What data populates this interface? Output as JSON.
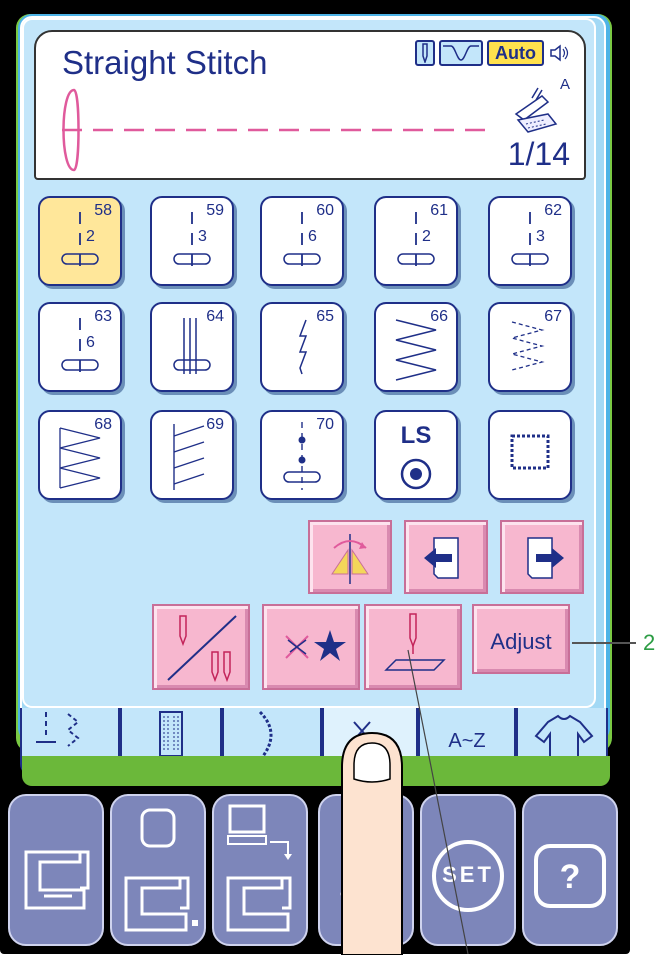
{
  "header": {
    "title": "Straight Stitch",
    "auto_label": "Auto",
    "presser_foot": "A",
    "page": "1/14"
  },
  "stitch_buttons": [
    {
      "num": "58",
      "value": "2",
      "selected": true
    },
    {
      "num": "59",
      "value": "3"
    },
    {
      "num": "60",
      "value": "6"
    },
    {
      "num": "61",
      "value": "2"
    },
    {
      "num": "62",
      "value": "3"
    },
    {
      "num": "63",
      "value": "6"
    },
    {
      "num": "64",
      "value": ""
    },
    {
      "num": "65",
      "value": ""
    },
    {
      "num": "66",
      "value": ""
    },
    {
      "num": "67",
      "value": ""
    },
    {
      "num": "68",
      "value": ""
    },
    {
      "num": "69",
      "value": ""
    },
    {
      "num": "70",
      "value": ""
    },
    {
      "num": "",
      "value": "LS"
    },
    {
      "num": "",
      "value": ""
    }
  ],
  "function_buttons": {
    "adjust_label": "Adjust"
  },
  "tabs": [
    {
      "name": "utility"
    },
    {
      "name": "buttonhole"
    },
    {
      "name": "decorative"
    },
    {
      "name": "favorite"
    },
    {
      "name": "alphabet",
      "label": "A~Z"
    },
    {
      "name": "garment"
    }
  ],
  "hardware_buttons": [
    {
      "name": "sewing-machine"
    },
    {
      "name": "embroidery"
    },
    {
      "name": "pc-link"
    },
    {
      "name": "memory"
    },
    {
      "name": "set",
      "label": "SET"
    },
    {
      "name": "help",
      "label": "?"
    }
  ],
  "callout": "2",
  "colors": {
    "screen": "#c3e6fa",
    "accent_pink": "#f7b7cf",
    "selected": "#ffe79a",
    "text": "#1f2f88",
    "hardware": "#7d86ba"
  }
}
